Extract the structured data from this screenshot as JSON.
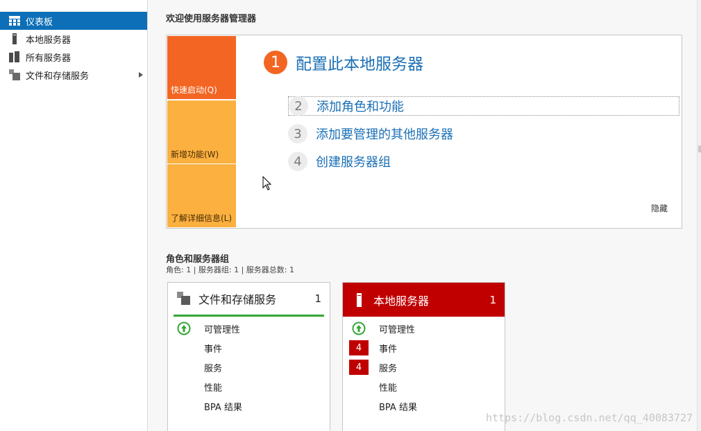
{
  "sidebar": {
    "items": [
      {
        "label": "仪表板",
        "icon": "dashboard-icon",
        "active": true
      },
      {
        "label": "本地服务器",
        "icon": "server-icon"
      },
      {
        "label": "所有服务器",
        "icon": "servers-icon"
      },
      {
        "label": "文件和存储服务",
        "icon": "file-storage-icon",
        "has_arrow": true
      }
    ]
  },
  "welcome": {
    "title": "欢迎使用服务器管理器",
    "tiles": [
      "快速启动(Q)",
      "新增功能(W)",
      "了解详细信息(L)"
    ],
    "main_step": {
      "num": "1",
      "label": "配置此本地服务器"
    },
    "steps": [
      {
        "num": "2",
        "label": "添加角色和功能"
      },
      {
        "num": "3",
        "label": "添加要管理的其他服务器"
      },
      {
        "num": "4",
        "label": "创建服务器组"
      }
    ],
    "hide_label": "隐藏"
  },
  "roles": {
    "title": "角色和服务器组",
    "subtitle": "角色: 1 | 服务器组: 1 | 服务器总数: 1",
    "cards": [
      {
        "title": "文件和存储服务",
        "count": "1",
        "rows": [
          {
            "label": "可管理性",
            "status": "ok"
          },
          {
            "label": "事件"
          },
          {
            "label": "服务"
          },
          {
            "label": "性能"
          },
          {
            "label": "BPA 结果"
          }
        ]
      },
      {
        "title": "本地服务器",
        "count": "1",
        "rows": [
          {
            "label": "可管理性",
            "status": "ok"
          },
          {
            "label": "事件",
            "badge": "4"
          },
          {
            "label": "服务",
            "badge": "4"
          },
          {
            "label": "性能"
          },
          {
            "label": "BPA 结果"
          }
        ]
      }
    ]
  },
  "watermark": "https://blog.csdn.net/qq_40083727",
  "colors": {
    "accent": "#0c6fb7",
    "quick_start": "#f26522",
    "tile": "#fbb040",
    "link": "#1b6fb5",
    "alert": "#c00000",
    "ok": "#36a536"
  }
}
